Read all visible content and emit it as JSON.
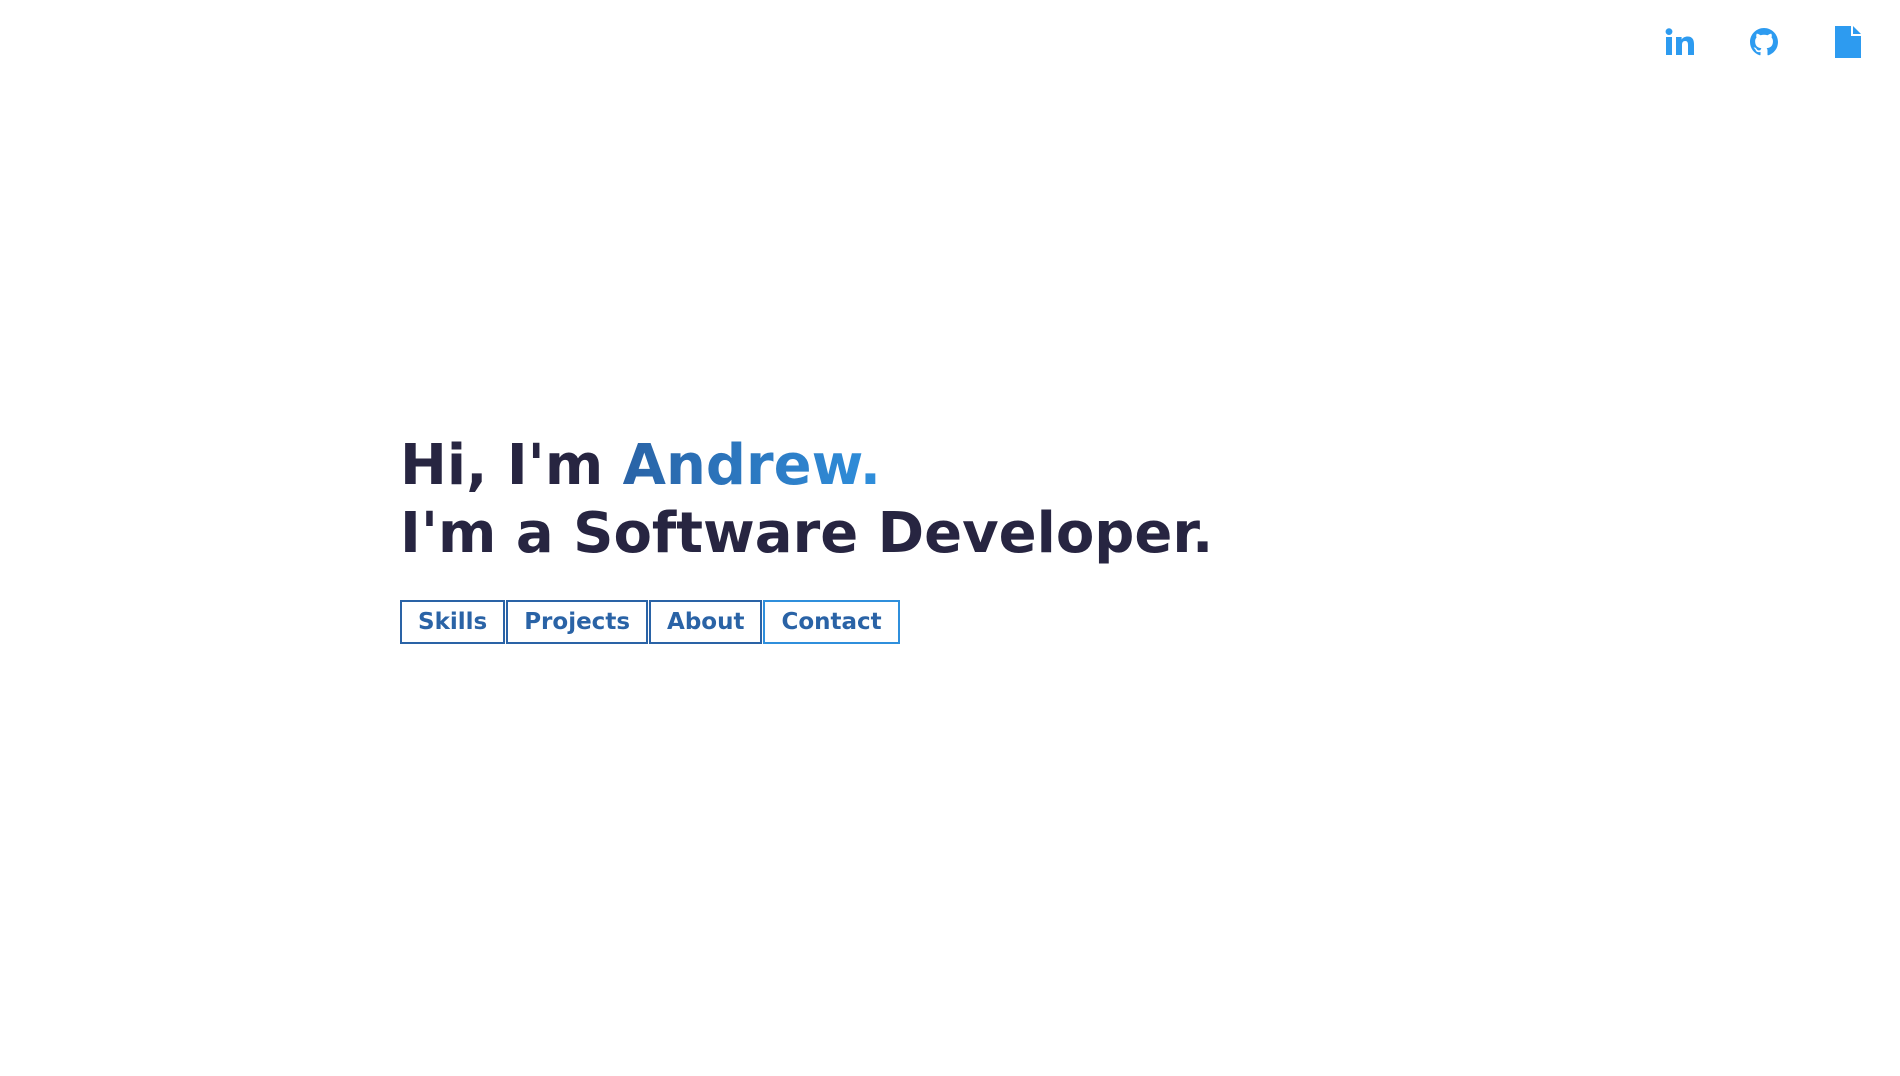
{
  "social": {
    "linkedin_icon": "linkedin-icon",
    "github_icon": "github-icon",
    "resume_icon": "document-icon",
    "icon_color": "#2d9bf0"
  },
  "hero": {
    "greeting_prefix": "Hi, I'm ",
    "name": "Andrew.",
    "tagline": "I'm a Software Developer.",
    "text_color": "#272541",
    "name_gradient": [
      "#2a63a6",
      "#2f8fdc"
    ]
  },
  "nav": {
    "skills": "Skills",
    "projects": "Projects",
    "about": "About",
    "contact": "Contact",
    "accent": "#2a63a6"
  }
}
